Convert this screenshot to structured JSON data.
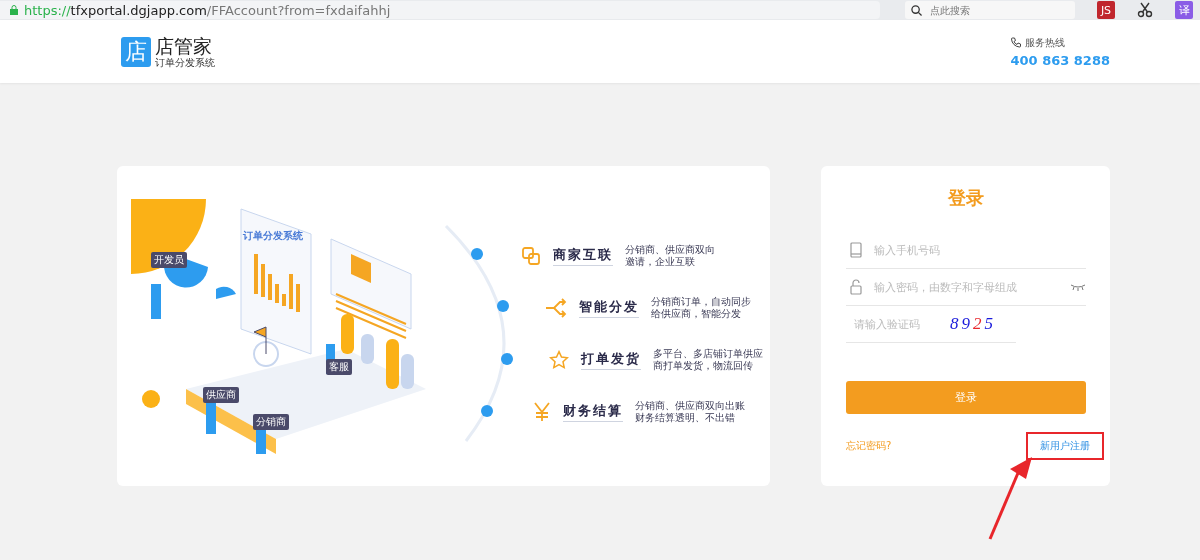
{
  "browser": {
    "url_scheme": "https://",
    "url_host": "tfxportal.dgjapp.com",
    "url_path": "/FFAccount?from=fxdaifahhj",
    "search": {
      "placeholder": "点此搜索"
    },
    "extensions": [
      {
        "kind": "js",
        "label": "JS"
      },
      {
        "kind": "scissors"
      },
      {
        "kind": "translate",
        "label": "译"
      }
    ]
  },
  "header": {
    "logo": {
      "mark": "店",
      "name": "店管家",
      "tagline": "订单分发系统"
    },
    "hotline": {
      "label": "服务热线",
      "number": "400 863 8288"
    }
  },
  "promo": {
    "illustration": {
      "board_title": "订单分发系统",
      "tags": [
        "开发员",
        "客服",
        "供应商",
        "分销商"
      ]
    },
    "features": [
      {
        "kind": "link",
        "title": "商家互联",
        "lines": [
          "分销商、供应商双向",
          "邀请，企业互联"
        ]
      },
      {
        "kind": "branch",
        "title": "智能分发",
        "lines": [
          "分销商订单，自动同步",
          "给供应商，智能分发"
        ]
      },
      {
        "kind": "star",
        "title": "打单发货",
        "lines": [
          "多平台、多店铺订单供应",
          "商打单发货，物流回传"
        ]
      },
      {
        "kind": "yen",
        "title": "财务结算",
        "lines": [
          "分销商、供应商双向出账",
          "财务结算透明、不出错"
        ]
      }
    ]
  },
  "login": {
    "title": "登录",
    "phone": {
      "placeholder": "输入手机号码"
    },
    "password": {
      "placeholder": "输入密码，由数字和字母组成"
    },
    "captcha": {
      "placeholder": "请输入验证码",
      "code": "8925"
    },
    "submit": "登录",
    "forgot": "忘记密码?",
    "register": "新用户注册",
    "register_highlighted": true
  }
}
